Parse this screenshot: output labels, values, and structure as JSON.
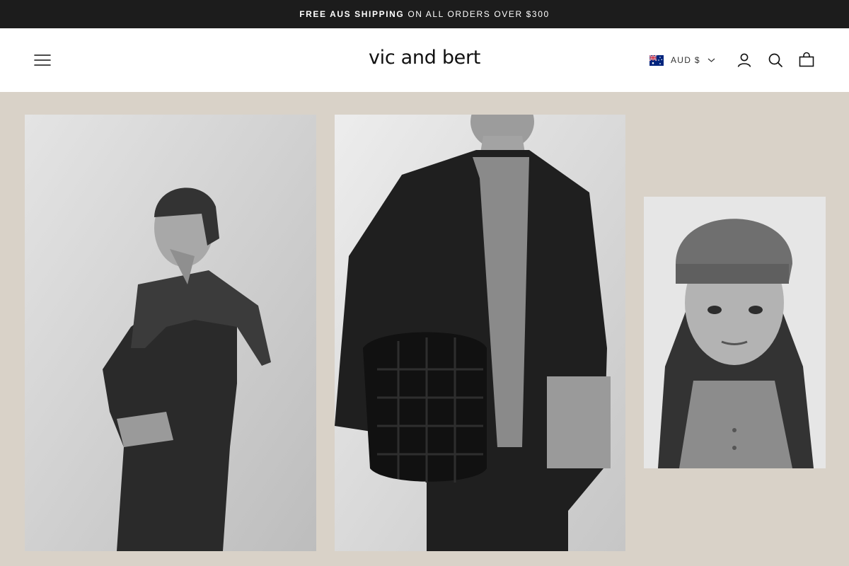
{
  "announcement": {
    "strong": "FREE AUS SHIPPING",
    "rest": "ON ALL ORDERS OVER $300"
  },
  "header": {
    "logo": "vic and bert",
    "currency": "AUD $",
    "icons": [
      "menu-icon",
      "australia-flag-icon",
      "chevron-down-icon",
      "account-icon",
      "search-icon",
      "cart-bag-icon"
    ]
  },
  "gallery": {
    "images": [
      {
        "subject": "woman-in-knit-sweater"
      },
      {
        "subject": "person-in-blazer-with-woven-bag"
      },
      {
        "subject": "woman-in-beanie-portrait"
      }
    ]
  },
  "colors": {
    "announcement_bg": "#1c1c1c",
    "header_bg": "#ffffff",
    "page_bg": "#d9d2c8"
  }
}
